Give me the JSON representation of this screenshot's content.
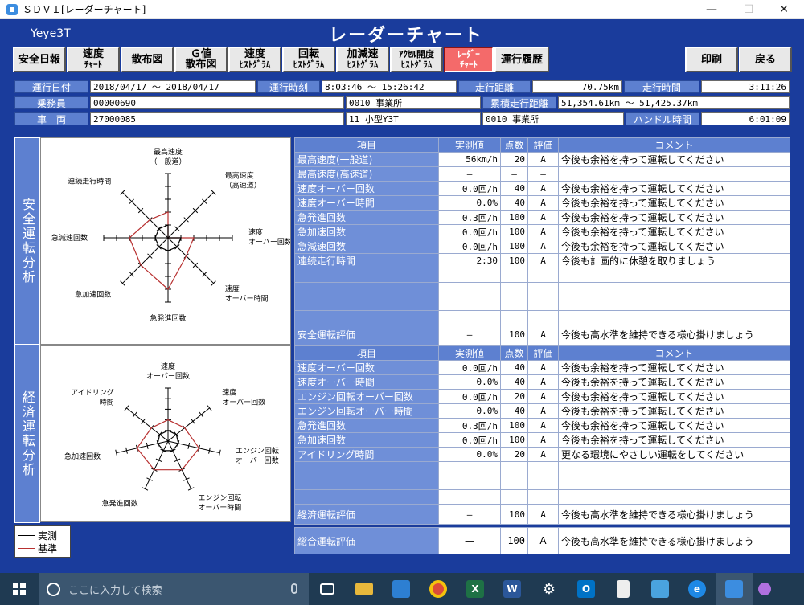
{
  "window": {
    "title": "ＳＤＶＩ[レーダーチャート]",
    "minimize": "—",
    "maximize": "☐",
    "close": "✕"
  },
  "header": {
    "vehicle_code": "Yeye3T",
    "title": "レーダーチャート"
  },
  "toolbar": {
    "safety_daily": "安全日報",
    "speed_chart_1": "速度",
    "speed_chart_2": "ﾁｬｰﾄ",
    "scatter": "散布図",
    "g_scatter_1": "Ｇ値",
    "g_scatter_2": "散布図",
    "speed_hist_1": "速度",
    "speed_hist_2": "ﾋｽﾄｸﾞﾗﾑ",
    "rpm_hist_1": "回転",
    "rpm_hist_2": "ﾋｽﾄｸﾞﾗﾑ",
    "accel_hist_1": "加減速",
    "accel_hist_2": "ﾋｽﾄｸﾞﾗﾑ",
    "pedal_hist_1": "ｱｸｾﾙ開度",
    "pedal_hist_2": "ﾋｽﾄｸﾞﾗﾑ",
    "radar_1": "ﾚｰﾀﾞｰ",
    "radar_2": "ﾁｬｰﾄ",
    "history": "運行履歴",
    "print": "印刷",
    "back": "戻る"
  },
  "info": {
    "date_label": "運行日付",
    "date_value": "2018/04/17 ～ 2018/04/17",
    "time_label": "運行時刻",
    "time_value": "8:03:46 ～ 15:26:42",
    "distance_label": "走行距離",
    "distance_value": "70.75km",
    "drive_time_label": "走行時間",
    "drive_time_value": "3:11:26",
    "crew_label": "乗務員",
    "crew_value": "00000690",
    "office_1": "0010 事業所",
    "cum_distance_label": "累積走行距離",
    "cum_distance_value": "51,354.61km ～ 51,425.37km",
    "vehicle_label": "車　両",
    "vehicle_value": "27000085",
    "vehicle_type": "11 小型Y3T",
    "office_2": "0010 事業所",
    "handle_time_label": "ハンドル時間",
    "handle_time_value": "6:01:09"
  },
  "sections": {
    "safety": "安全運転分析",
    "economy": "経済運転分析"
  },
  "table_headers": {
    "item": "項目",
    "measured": "実測値",
    "score": "点数",
    "grade": "評価",
    "comment": "コメント"
  },
  "safety_rows": [
    {
      "item": "最高速度(一般道)",
      "measured": "56km/h",
      "score": "20",
      "grade": "A",
      "comment": "今後も余裕を持って運転してください"
    },
    {
      "item": "最高速度(高速道)",
      "measured": "—",
      "score": "—",
      "grade": "—",
      "comment": ""
    },
    {
      "item": "速度オーバー回数",
      "measured": "0.0回/h",
      "score": "40",
      "grade": "A",
      "comment": "今後も余裕を持って運転してください"
    },
    {
      "item": "速度オーバー時間",
      "measured": "0.0%",
      "score": "40",
      "grade": "A",
      "comment": "今後も余裕を持って運転してください"
    },
    {
      "item": "急発進回数",
      "measured": "0.3回/h",
      "score": "100",
      "grade": "A",
      "comment": "今後も余裕を持って運転してください"
    },
    {
      "item": "急加速回数",
      "measured": "0.0回/h",
      "score": "100",
      "grade": "A",
      "comment": "今後も余裕を持って運転してください"
    },
    {
      "item": "急減速回数",
      "measured": "0.0回/h",
      "score": "100",
      "grade": "A",
      "comment": "今後も余裕を持って運転してください"
    },
    {
      "item": "連続走行時間",
      "measured": "2:30",
      "score": "100",
      "grade": "A",
      "comment": "今後も計画的に休憩を取りましょう"
    }
  ],
  "safety_summary": {
    "item": "安全運転評価",
    "measured": "—",
    "score": "100",
    "grade": "A",
    "comment": "今後も高水準を維持できる様心掛けましょう"
  },
  "economy_rows": [
    {
      "item": "速度オーバー回数",
      "measured": "0.0回/h",
      "score": "40",
      "grade": "A",
      "comment": "今後も余裕を持って運転してください"
    },
    {
      "item": "速度オーバー時間",
      "measured": "0.0%",
      "score": "40",
      "grade": "A",
      "comment": "今後も余裕を持って運転してください"
    },
    {
      "item": "エンジン回転オーバー回数",
      "measured": "0.0回/h",
      "score": "20",
      "grade": "A",
      "comment": "今後も余裕を持って運転してください"
    },
    {
      "item": "エンジン回転オーバー時間",
      "measured": "0.0%",
      "score": "40",
      "grade": "A",
      "comment": "今後も余裕を持って運転してください"
    },
    {
      "item": "急発進回数",
      "measured": "0.3回/h",
      "score": "100",
      "grade": "A",
      "comment": "今後も余裕を持って運転してください"
    },
    {
      "item": "急加速回数",
      "measured": "0.0回/h",
      "score": "100",
      "grade": "A",
      "comment": "今後も余裕を持って運転してください"
    },
    {
      "item": "アイドリング時間",
      "measured": "0.0%",
      "score": "20",
      "grade": "A",
      "comment": "更なる環境にやさしい運転をしてください"
    }
  ],
  "economy_summary": {
    "item": "経済運転評価",
    "measured": "—",
    "score": "100",
    "grade": "A",
    "comment": "今後も高水準を維持できる様心掛けましょう"
  },
  "total": {
    "item": "総合運転評価",
    "measured": "—",
    "score": "100",
    "grade": "A",
    "comment": "今後も高水準を維持できる様心掛けましょう"
  },
  "legend": {
    "measured": "実測",
    "standard": "基準"
  },
  "radar_safety": {
    "axes": [
      {
        "line1": "最高速度",
        "line2": "（一般道）"
      },
      {
        "line1": "最高速度",
        "line2": "（高速道）"
      },
      {
        "line1": "速度",
        "line2": "オーバー回数"
      },
      {
        "line1": "速度",
        "line2": "オーバー時間"
      },
      {
        "line1": "急発進回数",
        "line2": ""
      },
      {
        "line1": "急加速回数",
        "line2": ""
      },
      {
        "line1": "急減速回数",
        "line2": ""
      },
      {
        "line1": "連続走行時間",
        "line2": ""
      }
    ],
    "measured": [
      1,
      0,
      1,
      1,
      1,
      1,
      1,
      1
    ],
    "standard": [
      2,
      0,
      2,
      2,
      4,
      3,
      3,
      2
    ]
  },
  "radar_economy": {
    "axes": [
      {
        "line1": "速度",
        "line2": "オーバー回数"
      },
      {
        "line1": "速度",
        "line2": "オーバー回数"
      },
      {
        "line1": "エンジン回転",
        "line2": "オーバー回数"
      },
      {
        "line1": "エンジン回転",
        "line2": "オーバー時間"
      },
      {
        "line1": "急発進回数",
        "line2": ""
      },
      {
        "line1": "急加速回数",
        "line2": ""
      },
      {
        "line1": "アイドリング",
        "line2": "時間"
      }
    ],
    "measured": [
      1,
      1,
      1,
      1,
      1,
      1,
      1
    ],
    "standard": [
      2,
      2,
      3,
      3,
      3,
      3,
      2
    ]
  },
  "taskbar": {
    "search_placeholder": "ここに入力して検索"
  },
  "colors": {
    "window_bg": "#1a3c9c",
    "label_bg": "#5d80d0",
    "active_button": "#f46a6a",
    "standard_line": "#b83030"
  }
}
